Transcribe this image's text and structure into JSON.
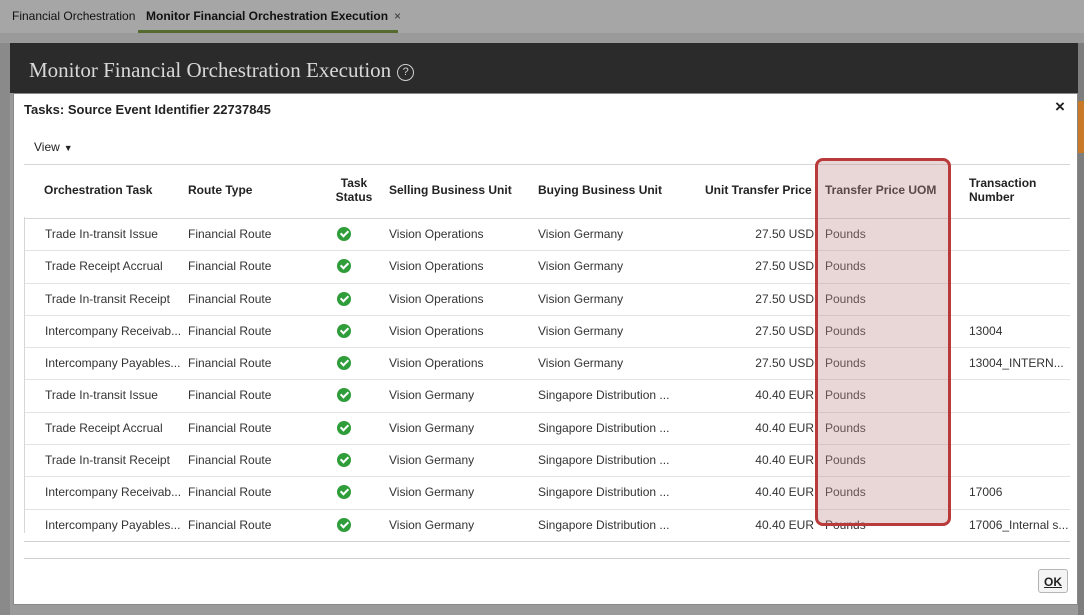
{
  "tabs": [
    {
      "label": "Financial Orchestration"
    },
    {
      "label": "Monitor Financial Orchestration Execution",
      "close": "×"
    }
  ],
  "page": {
    "title": "Monitor Financial Orchestration Execution",
    "help": "?"
  },
  "dialog": {
    "title": "Tasks: Source Event Identifier 22737845",
    "close": "×",
    "view_menu": "View",
    "ok_label": "OK"
  },
  "columns": [
    "Orchestration Task",
    "Route Type",
    "Task Status",
    "Selling Business Unit",
    "Buying Business Unit",
    "Unit Transfer Price",
    "Transfer Price UOM",
    "Transaction Number"
  ],
  "rows": [
    {
      "task": "Trade In-transit Issue",
      "route": "Financial Route",
      "status": "complete",
      "selling": "Vision Operations",
      "buying": "Vision Germany",
      "price": "27.50 USD",
      "uom": "Pounds",
      "txn": ""
    },
    {
      "task": "Trade Receipt Accrual",
      "route": "Financial Route",
      "status": "complete",
      "selling": "Vision Operations",
      "buying": "Vision Germany",
      "price": "27.50 USD",
      "uom": "Pounds",
      "txn": ""
    },
    {
      "task": "Trade In-transit Receipt",
      "route": "Financial Route",
      "status": "complete",
      "selling": "Vision Operations",
      "buying": "Vision Germany",
      "price": "27.50 USD",
      "uom": "Pounds",
      "txn": ""
    },
    {
      "task": "Intercompany Receivab...",
      "route": "Financial Route",
      "status": "complete",
      "selling": "Vision Operations",
      "buying": "Vision Germany",
      "price": "27.50 USD",
      "uom": "Pounds",
      "txn": "13004"
    },
    {
      "task": "Intercompany Payables...",
      "route": "Financial Route",
      "status": "complete",
      "selling": "Vision Operations",
      "buying": "Vision Germany",
      "price": "27.50 USD",
      "uom": "Pounds",
      "txn": "13004_INTERN..."
    },
    {
      "task": "Trade In-transit Issue",
      "route": "Financial Route",
      "status": "complete",
      "selling": "Vision Germany",
      "buying": "Singapore Distribution ...",
      "price": "40.40 EUR",
      "uom": "Pounds",
      "txn": ""
    },
    {
      "task": "Trade Receipt Accrual",
      "route": "Financial Route",
      "status": "complete",
      "selling": "Vision Germany",
      "buying": "Singapore Distribution ...",
      "price": "40.40 EUR",
      "uom": "Pounds",
      "txn": ""
    },
    {
      "task": "Trade In-transit Receipt",
      "route": "Financial Route",
      "status": "complete",
      "selling": "Vision Germany",
      "buying": "Singapore Distribution ...",
      "price": "40.40 EUR",
      "uom": "Pounds",
      "txn": ""
    },
    {
      "task": "Intercompany Receivab...",
      "route": "Financial Route",
      "status": "complete",
      "selling": "Vision Germany",
      "buying": "Singapore Distribution ...",
      "price": "40.40 EUR",
      "uom": "Pounds",
      "txn": "17006"
    },
    {
      "task": "Intercompany Payables...",
      "route": "Financial Route",
      "status": "complete",
      "selling": "Vision Germany",
      "buying": "Singapore Distribution ...",
      "price": "40.40 EUR",
      "uom": "Pounds",
      "txn": "17006_Internal s..."
    }
  ],
  "colors": {
    "status_ok": "#2e9d3a",
    "highlight_border": "#b83a3a",
    "header_bg": "#2b2b2b",
    "tab_underline": "#556b2f"
  },
  "icons": {
    "status": "check-circle-icon",
    "help": "help-circle-icon",
    "close": "close-icon",
    "view_caret": "caret-down-icon"
  }
}
